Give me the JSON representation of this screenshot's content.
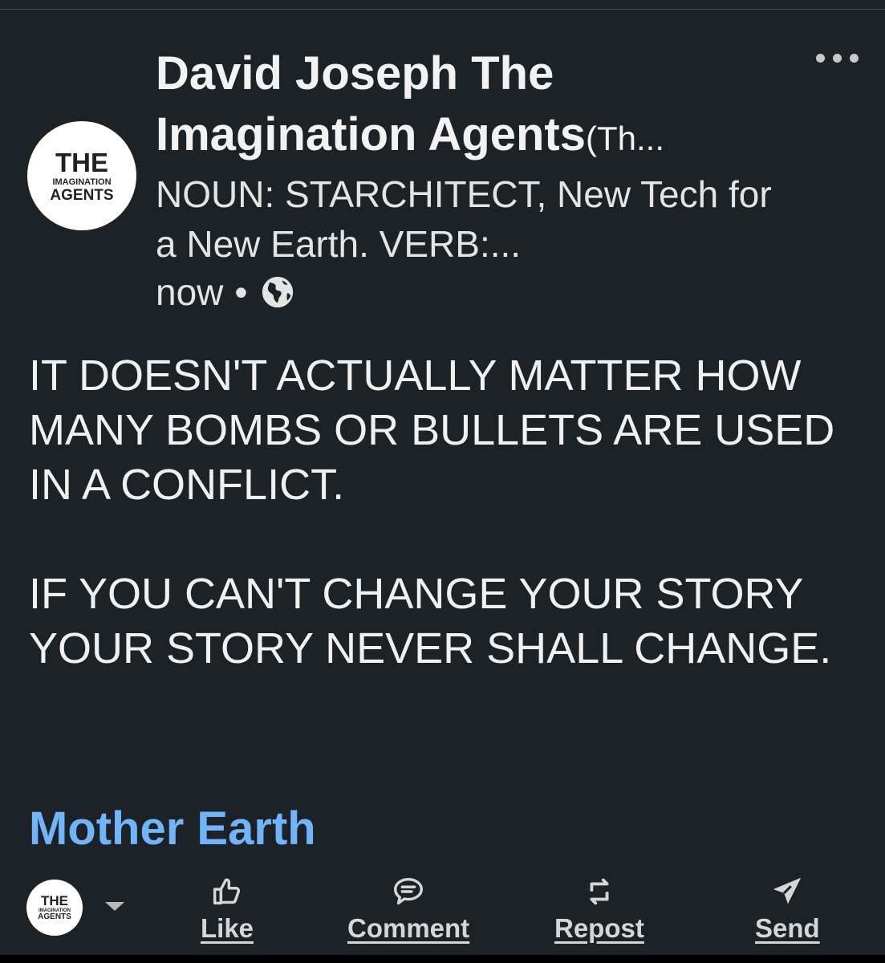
{
  "post": {
    "author_name": "David Joseph The Imagination Agents",
    "author_suffix": "(Th...",
    "headline": "NOUN: STARCHITECT, New Tech for a New Earth. VERB:...",
    "timestamp": "now",
    "separator": "•",
    "visibility_icon": "globe-icon",
    "more_icon": "more-options-icon",
    "body": "IT DOESN'T ACTUALLY MATTER HOW MANY BOMBS OR BULLETS ARE USED IN A CONFLICT.\n\nIF YOU CAN'T CHANGE YOUR STORY YOUR STORY NEVER SHALL CHANGE.",
    "hashtag": "Mother Earth"
  },
  "avatar": {
    "line1": "THE",
    "line2": "IMAGINATION",
    "line3": "AGENTS"
  },
  "actions": {
    "like_label": "Like",
    "comment_label": "Comment",
    "repost_label": "Repost",
    "send_label": "Send"
  },
  "colors": {
    "background": "#1d2226",
    "link": "#70b5f9",
    "text": "#f0f0f0"
  }
}
